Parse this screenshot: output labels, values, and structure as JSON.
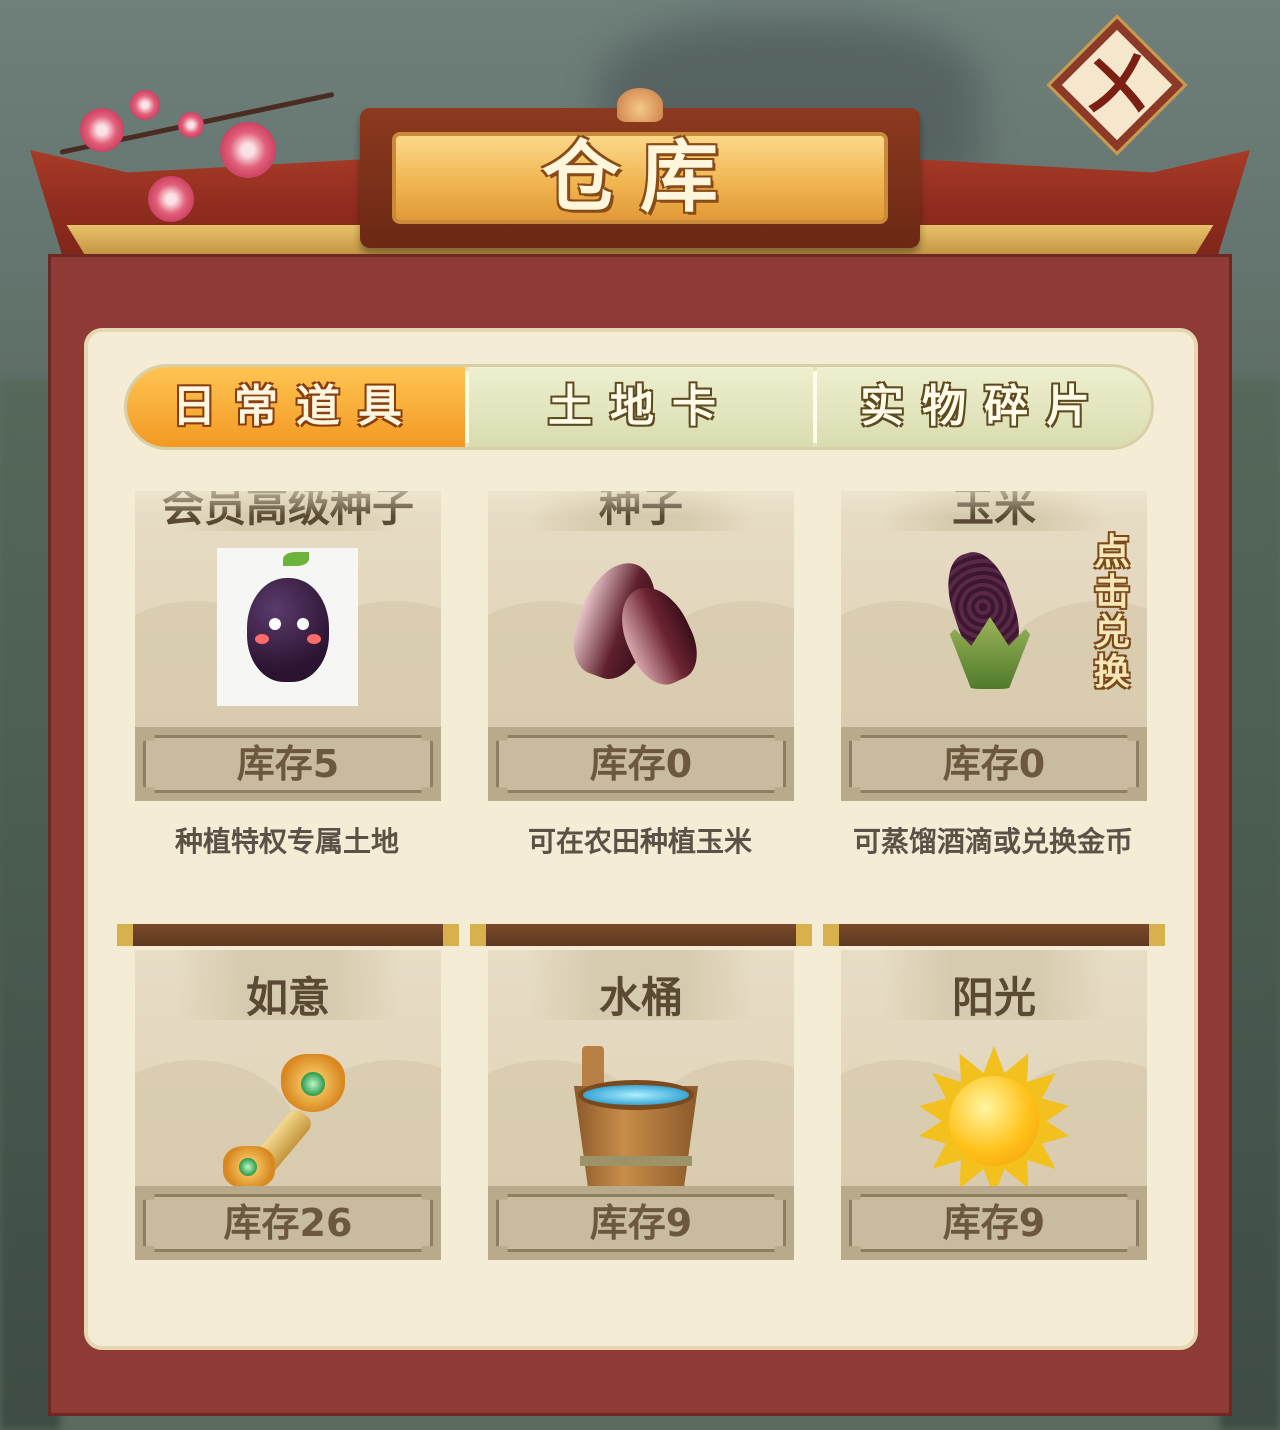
{
  "header": {
    "title": "仓库",
    "close_icon": "close-icon",
    "close_glyph": "ㄨ"
  },
  "tabs": [
    {
      "label": "日常道具",
      "active": true
    },
    {
      "label": "土地卡",
      "active": false
    },
    {
      "label": "实物碎片",
      "active": false
    }
  ],
  "items": [
    {
      "name": "会员高级种子",
      "icon": "eggplant-seed-icon",
      "stock": "库存5",
      "desc": "种植特权专属土地"
    },
    {
      "name": "种子",
      "icon": "seed-icon",
      "stock": "库存0",
      "desc": "可在农田种植玉米"
    },
    {
      "name": "玉米",
      "icon": "corn-icon",
      "stock": "库存0",
      "desc": "可蒸馏酒滴或兑换金币",
      "action": "点击兑换"
    },
    {
      "name": "如意",
      "icon": "ruyi-icon",
      "stock": "库存26"
    },
    {
      "name": "水桶",
      "icon": "bucket-icon",
      "stock": "库存9"
    },
    {
      "name": "阳光",
      "icon": "sun-icon",
      "stock": "库存9"
    }
  ],
  "colors": {
    "frame": "#8e3a35",
    "panel": "#f5ecd6",
    "tab_active": "#f29a23",
    "tab_inactive": "#d9dcb0"
  }
}
